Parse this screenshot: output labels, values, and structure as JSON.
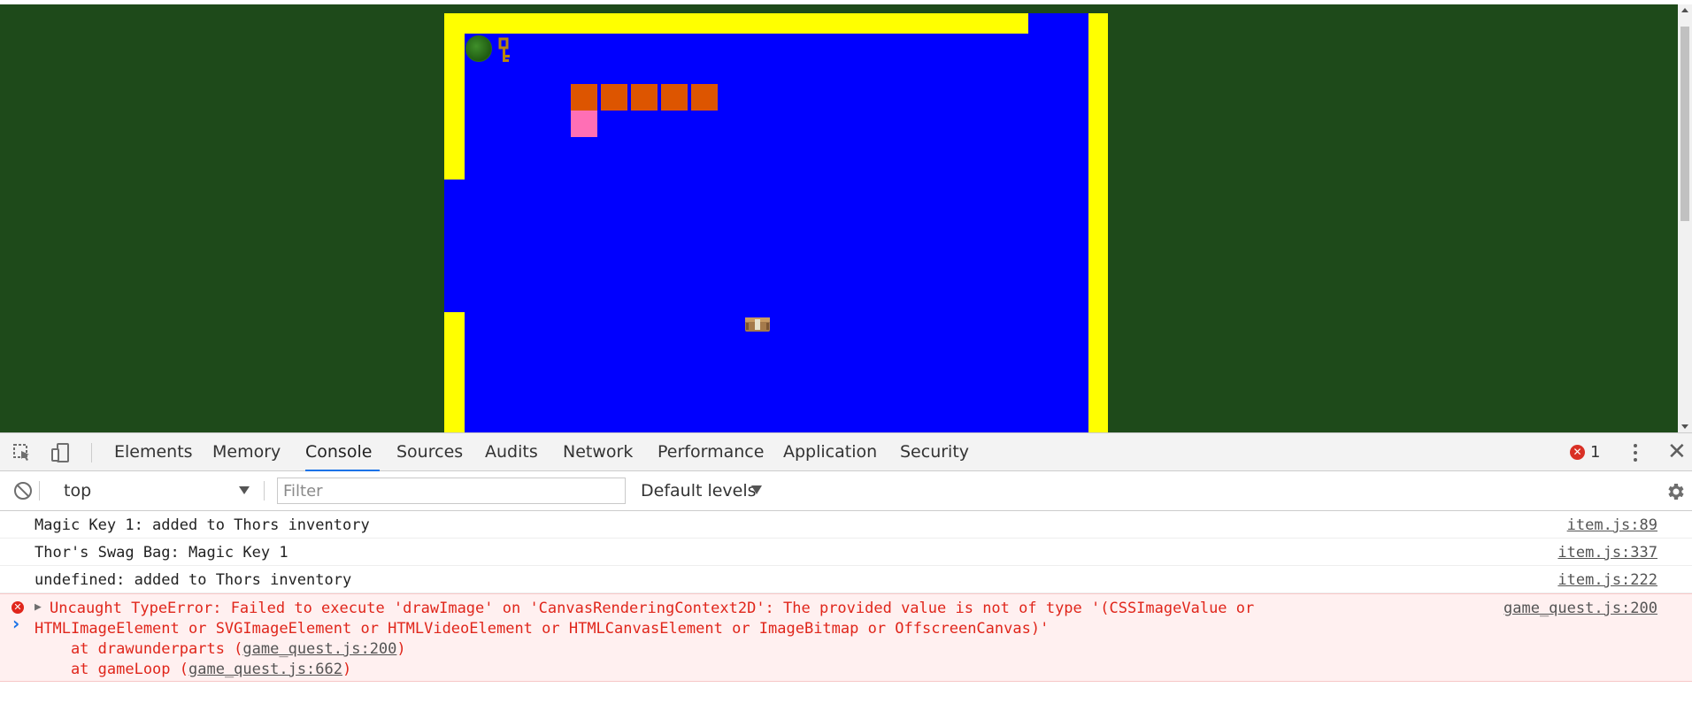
{
  "devtools": {
    "tabs": [
      {
        "label": "Elements"
      },
      {
        "label": "Memory"
      },
      {
        "label": "Console",
        "active": true
      },
      {
        "label": "Sources"
      },
      {
        "label": "Audits"
      },
      {
        "label": "Network"
      },
      {
        "label": "Performance"
      },
      {
        "label": "Application"
      },
      {
        "label": "Security"
      }
    ],
    "error_count": "1",
    "error_badge_glyph": "✕",
    "close_glyph": "✕"
  },
  "console_toolbar": {
    "context": "top",
    "filter_placeholder": "Filter",
    "levels_label": "Default levels"
  },
  "console": {
    "messages": [
      {
        "text": "Magic Key 1: added to Thors inventory",
        "source": "item.js:89"
      },
      {
        "text": "Thor's Swag Bag: Magic Key 1",
        "source": "item.js:337"
      },
      {
        "text": "undefined: added to Thors inventory",
        "source": "item.js:222"
      }
    ],
    "error": {
      "expand_glyph": "▶",
      "line1": "Uncaught TypeError: Failed to execute 'drawImage' on 'CanvasRenderingContext2D': The provided value is not of type '(CSSImageValue or",
      "line2": "HTMLImageElement or SVGImageElement or HTMLVideoElement or HTMLCanvasElement or ImageBitmap or OffscreenCanvas)'",
      "stack1_prefix": "    at drawunderparts (",
      "stack1_link": "game_quest.js:200",
      "stack1_suffix": ")",
      "stack2_prefix": "    at gameLoop (",
      "stack2_link": "game_quest.js:662",
      "stack2_suffix": ")",
      "source": "game_quest.js:200"
    },
    "prompt_glyph": "›"
  },
  "colors": {
    "page_background": "#1e4a1a",
    "canvas_floor": "#0000ff",
    "walls": "#ffff00",
    "blocks": "#dd5500",
    "pink_block": "#ff6fb5",
    "error_text": "#e0261b",
    "active_tab_underline": "#1a73e8"
  },
  "icons": [
    "inspect-element-icon",
    "device-toolbar-icon",
    "clear-console-icon",
    "settings-gear-icon",
    "more-options-icon",
    "close-icon",
    "error-icon"
  ]
}
